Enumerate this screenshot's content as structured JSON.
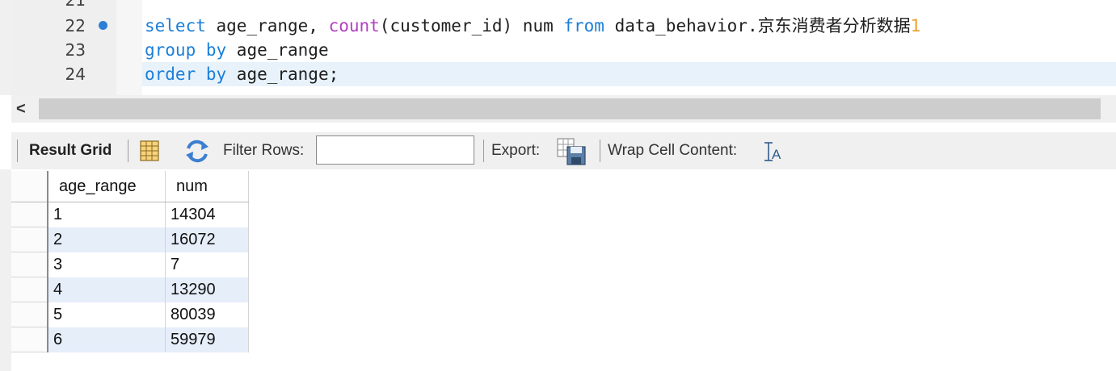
{
  "editor": {
    "lines": [
      {
        "num": "21"
      },
      {
        "num": "22",
        "tokens": [
          {
            "t": "select",
            "c": "kw"
          },
          {
            "t": " age_range, "
          },
          {
            "t": "count",
            "c": "fn"
          },
          {
            "t": "(customer_id) num "
          },
          {
            "t": "from",
            "c": "kw"
          },
          {
            "t": " data_behavior.京东消费者分析数据"
          },
          {
            "t": "1",
            "c": "err"
          }
        ]
      },
      {
        "num": "23",
        "tokens": [
          {
            "t": "group by",
            "c": "kw"
          },
          {
            "t": " age_range"
          }
        ]
      },
      {
        "num": "24",
        "tokens": [
          {
            "t": "order by",
            "c": "kw"
          },
          {
            "t": " age_range;"
          }
        ]
      }
    ],
    "breakpoint_line": "22"
  },
  "toolbar": {
    "result_grid_label": "Result Grid",
    "filter_label": "Filter Rows:",
    "filter_value": "",
    "export_label": "Export:",
    "wrap_label": "Wrap Cell Content:"
  },
  "grid": {
    "columns": [
      "age_range",
      "num"
    ],
    "rows": [
      [
        "1",
        "14304"
      ],
      [
        "2",
        "16072"
      ],
      [
        "3",
        "7"
      ],
      [
        "4",
        "13290"
      ],
      [
        "5",
        "80039"
      ],
      [
        "6",
        "59979"
      ]
    ]
  },
  "colors": {
    "keyword": "#1b7fd8",
    "function": "#b23fc1",
    "current_line": "#e8f2fb",
    "alt_row": "#e6eefa",
    "breakpoint": "#2a7fd6"
  },
  "icons": [
    "grid-layout-icon",
    "refresh-icon",
    "export-icon",
    "wrap-text-icon",
    "scroll-left-icon"
  ]
}
